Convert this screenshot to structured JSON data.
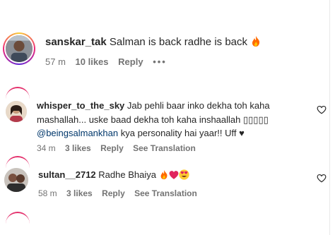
{
  "comments": [
    {
      "username": "sanskar_tak",
      "text": "Salman is back radhe is back",
      "emoji_names": [
        "fire"
      ],
      "time": "57 m",
      "likes": "10 likes",
      "reply": "Reply",
      "more": "•••"
    },
    {
      "username": "whisper_to_the_sky",
      "text_line1": "Jab pehli baar inko dekha toh kaha",
      "text_line2": "mashallah... uske baad dekha toh kaha inshaallah ▯▯▯▯▯",
      "mention": "@beingsalmankhan",
      "text_line3_rest": " kya personality hai yaar!! Uff ♥",
      "time": "34 m",
      "likes": "3 likes",
      "reply": "Reply",
      "see_translation": "See Translation",
      "like_icon": "heart-outline-icon"
    },
    {
      "username": "sultan__2712",
      "text": "Radhe Bhaiya",
      "emoji_names": [
        "fire",
        "red-heart",
        "heart-eyes"
      ],
      "time": "58 m",
      "likes": "3 likes",
      "reply": "Reply",
      "see_translation": "See Translation",
      "like_icon": "heart-outline-icon"
    }
  ],
  "colors": {
    "text": "#262626",
    "meta": "#737373",
    "mention": "#00376b",
    "fire": "#ff6a00",
    "heart": "#e0245e"
  }
}
